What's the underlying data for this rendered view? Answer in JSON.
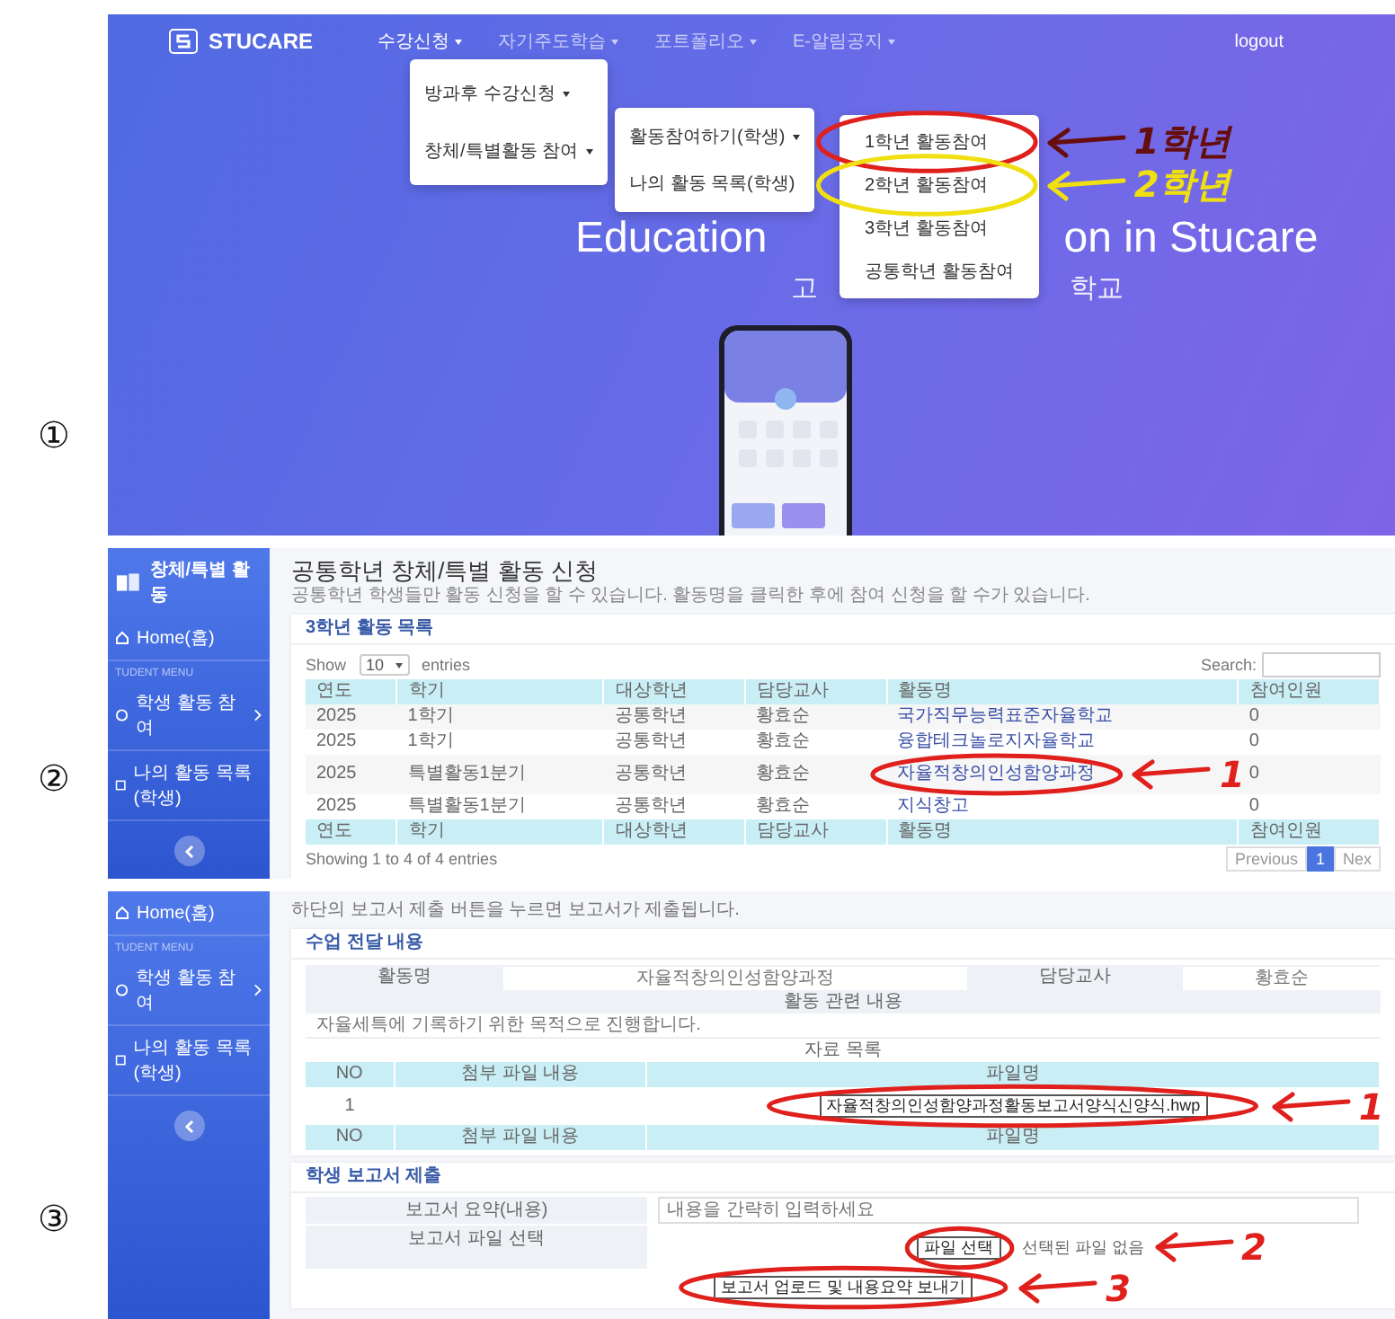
{
  "screen_1": {
    "number": "①",
    "brand": "STUCARE",
    "nav": [
      {
        "label": "수강신청",
        "selected": true
      },
      {
        "label": "자기주도학습",
        "selected": false
      },
      {
        "label": "포트폴리오",
        "selected": false
      },
      {
        "label": "E-알림공지",
        "selected": false
      }
    ],
    "logout": "logout",
    "menus": [
      {
        "items": [
          {
            "label": "방과후 수강신청",
            "has_submenu": true
          },
          {
            "label": "창체/특별활동 참여",
            "has_submenu": true
          }
        ]
      },
      {
        "items": [
          {
            "label": "활동참여하기(학생)",
            "has_submenu": true
          },
          {
            "label": "나의 활동 목록(학생)",
            "has_submenu": false
          }
        ]
      },
      {
        "items": [
          {
            "label": "1학년 활동참여",
            "has_submenu": false,
            "annotation": {
              "color": "#e0201c",
              "note": "1학년"
            }
          },
          {
            "label": "2학년 활동참여",
            "has_submenu": false,
            "annotation": {
              "color": "#f0e010",
              "note": "2학년"
            }
          },
          {
            "label": "3학년 활동참여",
            "has_submenu": false
          },
          {
            "label": "공통학년 활동참여",
            "has_submenu": false
          }
        ]
      }
    ],
    "hero_title": [
      "Education",
      "on in Stucare"
    ],
    "hero_subtitle": [
      "고",
      "학교"
    ]
  },
  "screen_2": {
    "number": "②",
    "sidebar": {
      "title": "창체/특별 활동",
      "items": [
        {
          "kind": "home",
          "label": "Home(홈)"
        },
        {
          "kind": "heading",
          "label": "TUDENT MENU"
        },
        {
          "kind": "group",
          "label": "학생 활동 참여"
        },
        {
          "kind": "link",
          "label": "나의 활동 목록(학생)"
        }
      ]
    },
    "page_title": "공통학년 창체/특별 활동 신청",
    "page_subtitle": "공통학년 학생들만 활동 신청을 할 수 있습니다. 활동명을 클릭한 후에 참여 신청을 할 수가 있습니다.",
    "card_title": "3학년 활동 목록",
    "show": {
      "before": "Show",
      "value": "10",
      "after": "entries"
    },
    "search_label": "Search:",
    "columns": [
      {
        "label": "연도",
        "kind": "text"
      },
      {
        "label": "학기",
        "kind": "text"
      },
      {
        "label": "대상학년",
        "kind": "text"
      },
      {
        "label": "담당교사",
        "kind": "text"
      },
      {
        "label": "활동명",
        "kind": "link"
      },
      {
        "label": "참여인원",
        "kind": "text"
      }
    ],
    "rows": [
      {
        "cells": [
          "2025",
          "1학기",
          "공통학년",
          "황효순",
          "국가직무능력표준자율학교",
          "0"
        ]
      },
      {
        "cells": [
          "2025",
          "1학기",
          "공통학년",
          "황효순",
          "융합테크놀로지자율학교",
          "0"
        ]
      },
      {
        "cells": [
          "2025",
          "특별활동1분기",
          "공통학년",
          "황효순",
          "자율적창의인성함양과정",
          "0"
        ],
        "annotation": {
          "color": "#e0201c",
          "note": "1"
        }
      },
      {
        "cells": [
          "2025",
          "특별활동1분기",
          "공통학년",
          "황효순",
          "지식창고",
          "0"
        ]
      }
    ],
    "footer_columns": [
      "연도",
      "학기",
      "대상학년",
      "담당교사",
      "활동명",
      "참여인원"
    ],
    "info": "Showing 1 to 4 of 4 entries",
    "pagination": [
      {
        "label": "Previous",
        "selected": false
      },
      {
        "label": "1",
        "selected": true
      },
      {
        "label": "Nex",
        "selected": false
      }
    ]
  },
  "screen_3": {
    "number": "③",
    "sidebar": {
      "items": [
        {
          "kind": "home",
          "label": "Home(홈)"
        },
        {
          "kind": "heading",
          "label": "TUDENT MENU"
        },
        {
          "kind": "group",
          "label": "학생 활동 참여"
        },
        {
          "kind": "link",
          "label": "나의 활동 목록(학생)"
        }
      ]
    },
    "notice": "하단의 보고서 제출 버튼을 누르면 보고서가 제출됩니다.",
    "info_card": {
      "title": "수업 전달 내용",
      "fields": [
        {
          "label": "활동명",
          "value": "자율적창의인성함양과정"
        },
        {
          "label": "담당교사",
          "value": "황효순"
        }
      ],
      "content_heading": "활동 관련 내용",
      "content_text": "자율세특에 기록하기 위한 목적으로 진행합니다.",
      "files_heading": "자료 목록",
      "file_columns": [
        "NO",
        "첨부 파일 내용",
        "파일명"
      ],
      "files": [
        {
          "no": "1",
          "file": "자율적창의인성함양과정활동보고서양식신양식.hwp",
          "annotation": {
            "color": "#e0201c",
            "note": "1"
          }
        }
      ],
      "file_footer": [
        "NO",
        "첨부 파일 내용",
        "파일명"
      ]
    },
    "report_card": {
      "title": "학생 보고서 제출",
      "summary": {
        "label": "보고서 요약(내용)",
        "placeholder": "내용을 간략히 입력하세요"
      },
      "file": {
        "label": "보고서 파일 선택",
        "button": "파일 선택",
        "status": "선택된 파일 없음",
        "annotation": {
          "color": "#e0201c",
          "note": "2"
        }
      },
      "submit": {
        "label": "보고서 업로드 및 내용요약 보내기",
        "annotation": {
          "color": "#e0201c",
          "note": "3"
        }
      }
    }
  }
}
